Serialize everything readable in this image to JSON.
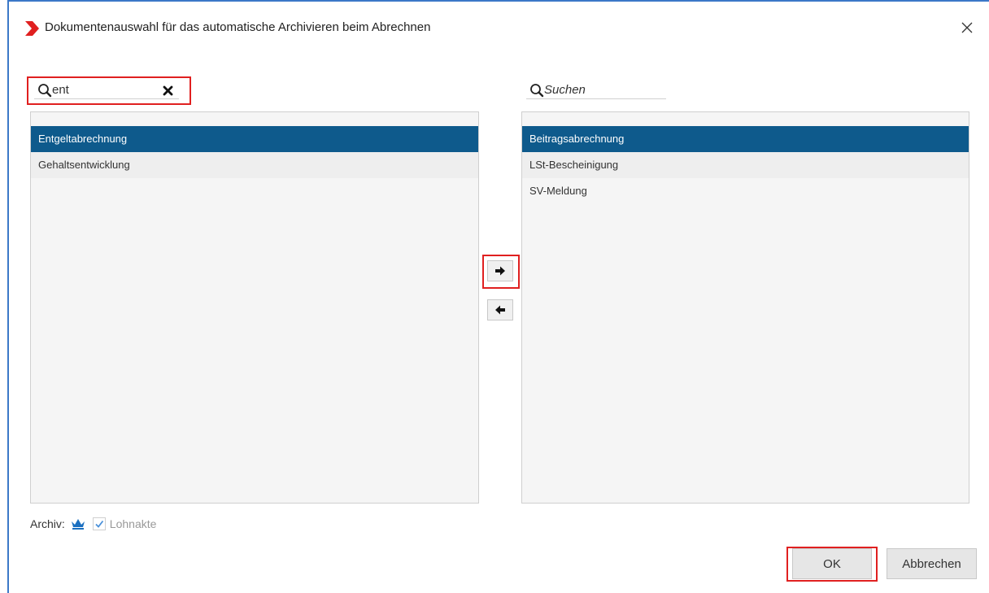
{
  "dialog": {
    "title": "Dokumentenauswahl für das automatische Archivieren beim Abrechnen",
    "accent_color": "#e02020",
    "border_color": "#3c78c8"
  },
  "left": {
    "search_value": "ent",
    "items": [
      {
        "label": "Entgeltabrechnung",
        "selected": true
      },
      {
        "label": "Gehaltsentwicklung",
        "selected": false
      }
    ]
  },
  "right": {
    "search_placeholder": "Suchen",
    "items": [
      {
        "label": "Beitragsabrechnung",
        "selected": true
      },
      {
        "label": "LSt-Bescheinigung",
        "selected": false
      },
      {
        "label": "SV-Meldung",
        "selected": false
      }
    ]
  },
  "archiv": {
    "label": "Archiv:",
    "checkbox_label": "Lohnakte",
    "checked": true
  },
  "buttons": {
    "ok": "OK",
    "cancel": "Abbrechen"
  },
  "selection_color": "#0e5a8c"
}
